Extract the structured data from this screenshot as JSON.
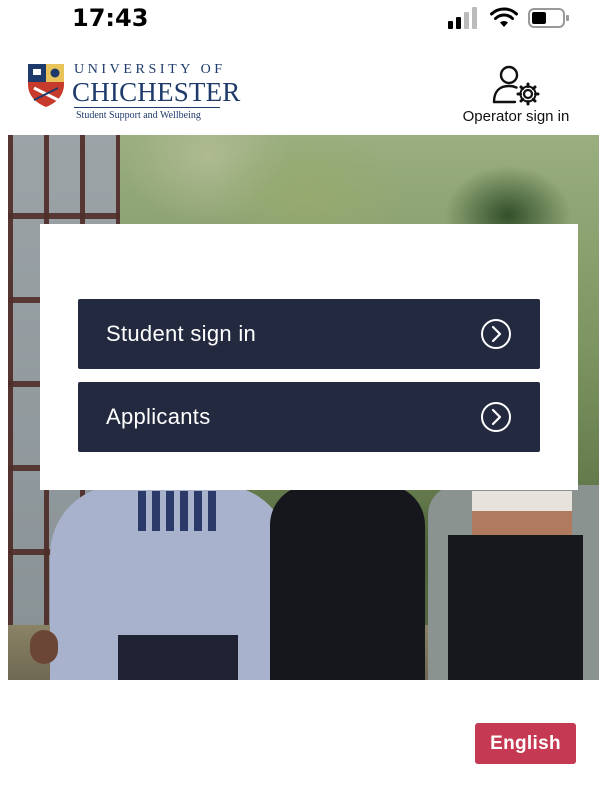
{
  "status_bar": {
    "time": "17:43",
    "icons": [
      "cellular-signal-icon",
      "wifi-icon",
      "battery-icon"
    ]
  },
  "header": {
    "logo": {
      "line_top": "UNIVERSITY OF",
      "line_main": "CHICHESTER",
      "line_sub": "Student Support and Wellbeing"
    },
    "operator_sign_in": {
      "label": "Operator sign in",
      "icon": "user-gear-icon"
    }
  },
  "card": {
    "buttons": [
      {
        "label": "Student sign in",
        "icon": "chevron-right-circle-icon"
      },
      {
        "label": "Applicants",
        "icon": "chevron-right-circle-icon"
      }
    ]
  },
  "language": {
    "label": "English"
  },
  "colors": {
    "button_dark": "#232a40",
    "language_accent": "#c53a52",
    "logo_blue": "#1e3a6a"
  }
}
